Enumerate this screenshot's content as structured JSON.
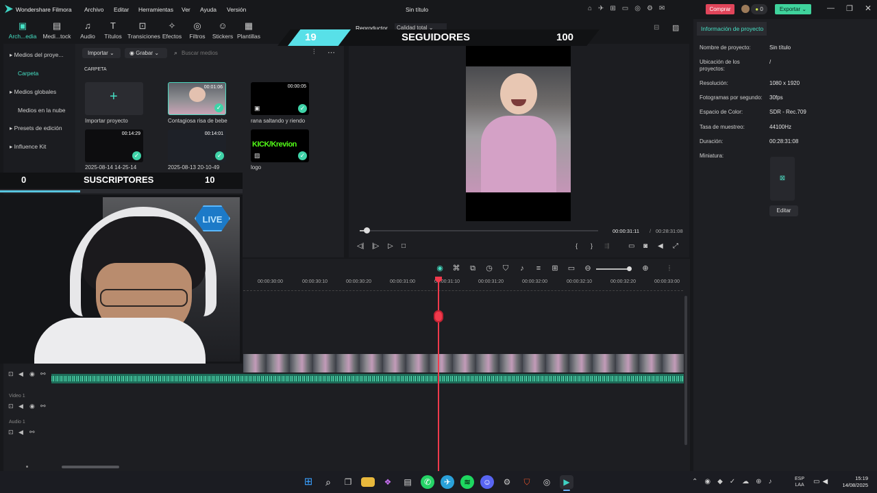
{
  "app": {
    "name": "Wondershare Filmora",
    "doc_title": "Sin título"
  },
  "menu": [
    "Archivo",
    "Editar",
    "Herramientas",
    "Ver",
    "Ayuda",
    "Versión"
  ],
  "topright": {
    "buy": "Comprar",
    "export": "Exportar",
    "badge": "0"
  },
  "tools": [
    {
      "label": "Arch...edia",
      "icon": "media-icon"
    },
    {
      "label": "Medi...tock",
      "icon": "stock-media-icon"
    },
    {
      "label": "Audio",
      "icon": "audio-icon"
    },
    {
      "label": "Títulos",
      "icon": "titles-icon"
    },
    {
      "label": "Transiciones",
      "icon": "transitions-icon"
    },
    {
      "label": "Efectos",
      "icon": "effects-icon"
    },
    {
      "label": "Filtros",
      "icon": "filters-icon"
    },
    {
      "label": "Stickers",
      "icon": "stickers-icon"
    },
    {
      "label": "Plantillas",
      "icon": "templates-icon"
    }
  ],
  "sidebar": [
    {
      "label": "Medios del proye...",
      "expand": true
    },
    {
      "label": "Carpeta",
      "active": true
    },
    {
      "label": "Medios globales",
      "expand": true
    },
    {
      "label": "Medios en la nube"
    },
    {
      "label": "Presets de edición",
      "expand": true
    },
    {
      "label": "Influence Kit",
      "expand": true
    }
  ],
  "media_bar": {
    "import": "Importar",
    "record": "Grabar",
    "search_placeholder": "Buscar medios",
    "folder": "CARPETA"
  },
  "media": [
    {
      "label": "Importar proyecto",
      "dur": ""
    },
    {
      "label": "Contagiosa risa de bebe",
      "dur": "00:01:06"
    },
    {
      "label": "rana saltando y riendo",
      "dur": "00:00:05"
    },
    {
      "label": "2025-08-14 14-25-14",
      "dur": "00:14:29"
    },
    {
      "label": "2025-08-13 20-10-49",
      "dur": "00:14:01"
    },
    {
      "label": "logo",
      "dur": "",
      "logo_text": "KICK/Krevion"
    }
  ],
  "overlay_followers": {
    "left": "19",
    "title": "SEGUIDORES",
    "right": "100"
  },
  "overlay_subs": {
    "left": "0",
    "title": "SUSCRIPTORES",
    "right": "10"
  },
  "live_badge": "LIVE",
  "player": {
    "tab": "Reproductor",
    "quality": "Calidad total",
    "current": "00:00:31:11",
    "sep": "/",
    "total": "00:28:31:08",
    "progress": 0.02
  },
  "props": {
    "tab": "Información de proyecto",
    "rows": [
      {
        "k": "Nombre de proyecto:",
        "v": "Sin título"
      },
      {
        "k": "Ubicación de los proyectos:",
        "v": "/"
      },
      {
        "k": "Resolución:",
        "v": "1080 x 1920"
      },
      {
        "k": "Fotogramas por segundo:",
        "v": "30fps"
      },
      {
        "k": "Espacio de Color:",
        "v": "SDR - Rec.709"
      },
      {
        "k": "Tasa de muestreo:",
        "v": "44100Hz"
      },
      {
        "k": "Duración:",
        "v": "00:28:31:08"
      },
      {
        "k": "Miniatura:",
        "v": ""
      }
    ],
    "edit": "Editar"
  },
  "ruler": [
    "00:00:30:00",
    "00:00:30:10",
    "00:00:30:20",
    "00:00:31:00",
    "00:00:31:10",
    "00:00:31:20",
    "00:00:32:00",
    "00:00:32:10",
    "00:00:32:20",
    "00:00:33:00"
  ],
  "tracks": {
    "video": "Video 1",
    "audio": "Audio 1"
  },
  "taskbar": {
    "lang1": "ESP",
    "lang2": "LAA",
    "time": "15:19",
    "date": "14/08/2025"
  }
}
